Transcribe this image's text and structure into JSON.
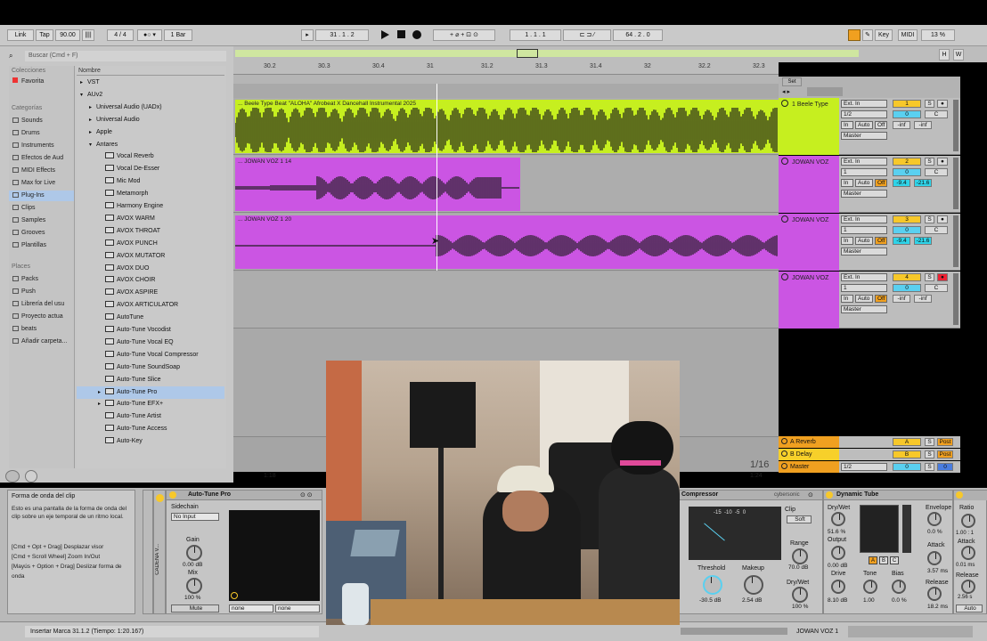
{
  "transport": {
    "link": "Link",
    "tap": "Tap",
    "tempo": "90.00",
    "signature": "4 / 4",
    "quantize": "1 Bar",
    "position": "31 .  1 .  2",
    "loop_start": "1 .  1 .  1",
    "loop_length": "64 .  2 .  0",
    "key": "Key",
    "midi": "MIDI",
    "cpu": "13 %",
    "h": "H",
    "w": "W"
  },
  "browser": {
    "search_placeholder": "Buscar (Cmd + F)",
    "collections_header": "Colecciones",
    "favorites": "Favorita",
    "categories_header": "Categorías",
    "categories": [
      "Sounds",
      "Drums",
      "Instruments",
      "Efectos de Aud",
      "MIDI Effects",
      "Max for Live",
      "Plug-Ins",
      "Clips",
      "Samples",
      "Grooves",
      "Plantillas"
    ],
    "places_header": "Places",
    "places": [
      "Packs",
      "Push",
      "Librería del usu",
      "Proyecto actua",
      "beats",
      "Añadir carpeta..."
    ],
    "name_header": "Nombre",
    "tree": [
      {
        "label": "VST",
        "level": 0,
        "arrow": "▸"
      },
      {
        "label": "AUv2",
        "level": 0,
        "arrow": "▾"
      },
      {
        "label": "Universal Audio (UADx)",
        "level": 1,
        "arrow": "▸"
      },
      {
        "label": "Universal Audio",
        "level": 1,
        "arrow": "▸"
      },
      {
        "label": "Apple",
        "level": 1,
        "arrow": "▸"
      },
      {
        "label": "Antares",
        "level": 1,
        "arrow": "▾"
      },
      {
        "label": "Vocal Reverb",
        "level": 2,
        "arrow": ""
      },
      {
        "label": "Vocal De-Esser",
        "level": 2,
        "arrow": ""
      },
      {
        "label": "Mic Mod",
        "level": 2,
        "arrow": ""
      },
      {
        "label": "Metamorph",
        "level": 2,
        "arrow": ""
      },
      {
        "label": "Harmony Engine",
        "level": 2,
        "arrow": ""
      },
      {
        "label": "AVOX WARM",
        "level": 2,
        "arrow": ""
      },
      {
        "label": "AVOX THROAT",
        "level": 2,
        "arrow": ""
      },
      {
        "label": "AVOX PUNCH",
        "level": 2,
        "arrow": ""
      },
      {
        "label": "AVOX MUTATOR",
        "level": 2,
        "arrow": ""
      },
      {
        "label": "AVOX DUO",
        "level": 2,
        "arrow": ""
      },
      {
        "label": "AVOX CHOIR",
        "level": 2,
        "arrow": ""
      },
      {
        "label": "AVOX ASPIRE",
        "level": 2,
        "arrow": ""
      },
      {
        "label": "AVOX ARTICULATOR",
        "level": 2,
        "arrow": ""
      },
      {
        "label": "AutoTune",
        "level": 2,
        "arrow": ""
      },
      {
        "label": "Auto-Tune Vocodist",
        "level": 2,
        "arrow": ""
      },
      {
        "label": "Auto-Tune Vocal EQ",
        "level": 2,
        "arrow": ""
      },
      {
        "label": "Auto-Tune Vocal Compressor",
        "level": 2,
        "arrow": ""
      },
      {
        "label": "Auto-Tune SoundSoap",
        "level": 2,
        "arrow": ""
      },
      {
        "label": "Auto-Tune Slice",
        "level": 2,
        "arrow": ""
      },
      {
        "label": "Auto-Tune Pro",
        "level": 2,
        "arrow": "▸"
      },
      {
        "label": "Auto-Tune EFX+",
        "level": 2,
        "arrow": "▸"
      },
      {
        "label": "Auto-Tune Artist",
        "level": 2,
        "arrow": ""
      },
      {
        "label": "Auto-Tune Access",
        "level": 2,
        "arrow": ""
      },
      {
        "label": "Auto-Key",
        "level": 2,
        "arrow": ""
      }
    ]
  },
  "ruler": [
    "30.2",
    "30.3",
    "30.4",
    "31",
    "31.2",
    "31.3",
    "31.4",
    "32",
    "32.2",
    "32.3"
  ],
  "timeline": {
    "set": "Set",
    "bottom_left": "1:18",
    "bottom_right": "1:24",
    "zoom": "1/16"
  },
  "tracks": [
    {
      "clip": "... Beele Type Beat \"ALOHA\" Afrobeat X Dancehall Instrumental 2025",
      "name": "1 Beele Type",
      "color": "#c6ef1f",
      "input": "Ext. In",
      "channel": "1/2",
      "number": "1",
      "vol": "0",
      "pan": "C",
      "in": "In",
      "auto": "Auto",
      "off": "Off",
      "out": "Master",
      "peak_l": "-inf",
      "peak_r": "-inf"
    },
    {
      "clip": "... JOWAN VOZ 1 14",
      "name": "JOWAN VOZ",
      "color": "#cb55e3",
      "input": "Ext. In",
      "channel": "1",
      "number": "2",
      "vol": "0",
      "pan": "C",
      "in": "In",
      "auto": "Auto",
      "off": "Off",
      "out": "Master",
      "peak_l": "-9.4",
      "peak_r": "-21.6"
    },
    {
      "clip": "... JOWAN VOZ 1 20",
      "name": "JOWAN VOZ",
      "color": "#cb55e3",
      "input": "Ext. In",
      "channel": "1",
      "number": "3",
      "vol": "0",
      "pan": "C",
      "in": "In",
      "auto": "Auto",
      "off": "Off",
      "out": "Master",
      "peak_l": "-9.4",
      "peak_r": "-21.6"
    },
    {
      "clip": "",
      "name": "JOWAN VOZ",
      "color": "#cb55e3",
      "input": "Ext. In",
      "channel": "1",
      "number": "4",
      "vol": "0",
      "pan": "C",
      "in": "In",
      "auto": "Auto",
      "off": "Off",
      "out": "Master",
      "peak_l": "-inf",
      "peak_r": "-inf"
    }
  ],
  "returns": [
    {
      "name": "A Reverb",
      "letter": "A",
      "post": "Post"
    },
    {
      "name": "B Delay",
      "letter": "B",
      "post": "Post"
    },
    {
      "name": "Master",
      "letter": "0",
      "post": "0",
      "channel": "1/2"
    }
  ],
  "info": {
    "title": "Forma de onda del clip",
    "body": "Esto es una pantalla de la forma de onda del clip sobre un eje temporal de un ritmo local.",
    "hints": "[Cmd + Opt + Drag] Desplazar visor\n[Cmd + Scroll Wheel] Zoom In/Out\n[Mayús + Option + Drag] Deslizar forma de onda"
  },
  "device": {
    "chain": "CADENA V...",
    "autotune": {
      "title": "Auto-Tune Pro",
      "sidechain": "Sidechain",
      "input": "No Input",
      "gain_label": "Gain",
      "gain": "0.00 dB",
      "mix_label": "Mix",
      "mix": "100 %",
      "mute": "Mute",
      "sel1": "none",
      "sel2": "none"
    },
    "compressor": {
      "title": "Compressor",
      "brand": "cybersonic",
      "clip": "Clip",
      "soft": "Soft",
      "scale": [
        "-15",
        "-10",
        "-5",
        "0"
      ],
      "threshold_label": "Threshold",
      "threshold": "-30.5 dB",
      "makeup_label": "Makeup",
      "makeup": "2.54 dB",
      "range_label": "Range",
      "range": "70.0 dB",
      "drywet_label": "Dry/Wet",
      "drywet": "100 %"
    },
    "tube": {
      "title": "Dynamic Tube",
      "drywet_label": "Dry/Wet",
      "drywet": "51.6 %",
      "output_label": "Output",
      "output": "0.00 dB",
      "drive_label": "Drive",
      "drive": "8.10 dB",
      "tone_label": "Tone",
      "tone": "1.00",
      "bias_label": "Bias",
      "bias": "0.0 %",
      "envelope_label": "Envelope",
      "envelope": "0.0 %",
      "attack_label": "Attack",
      "attack": "3.57 ms",
      "release_label": "Release",
      "release": "18.2 ms",
      "abc": [
        "A",
        "B",
        "C"
      ]
    },
    "extra": {
      "ratio_label": "Ratio",
      "ratio": "1.00 : 1",
      "attack_label": "Attack",
      "attack": "0.01 ms",
      "release_label": "Release",
      "release": "2.56 s",
      "auto": "Auto"
    }
  },
  "status": {
    "message": "Insertar Marca 31.1.2 (Tiempo: 1:20.167)",
    "track": "JOWAN VOZ 1"
  },
  "colors": {
    "green": "#c6ef1f",
    "purple": "#cb55e3",
    "orange": "#f0a020",
    "yellow": "#f7d02a",
    "blue": "#5ad0f0"
  }
}
